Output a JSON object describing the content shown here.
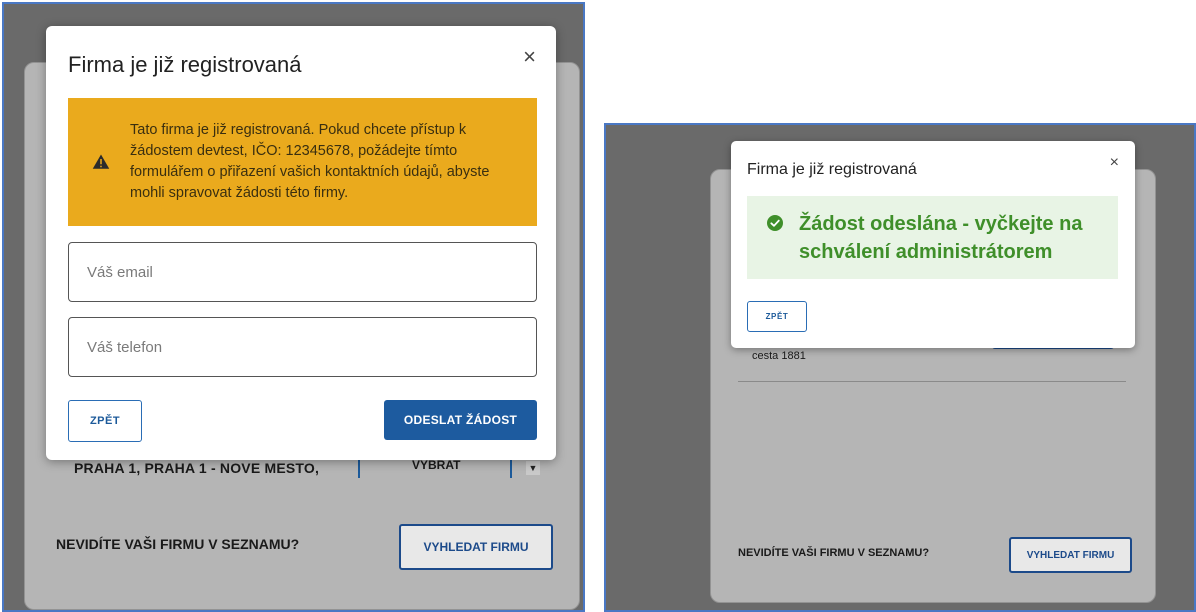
{
  "left": {
    "background": {
      "address": "PRAHA 1, PRAHA 1 - NOVE MESTO,",
      "select_button": "VYBRAT",
      "missing_company": "NEVIDÍTE VAŠI FIRMU V SEZNAMU?",
      "search_button": "VYHLEDAT FIRMU"
    },
    "modal": {
      "title": "Firma je již registrovaná",
      "close": "×",
      "warning": "Tato firma je již registrovaná. Pokud chcete přístup k žádostem devtest, IČO: 12345678, požádejte tímto formulářem o přiřazení vašich kontaktních údajů, abyste mohli spravovat žádosti této firmy.",
      "email_placeholder": "Váš email",
      "phone_placeholder": "Váš telefon",
      "back_button": "ZPĚT",
      "send_button": "ODESLAT ŽÁDOST"
    }
  },
  "right": {
    "background": {
      "street": "cesta 1881",
      "missing_company": "NEVIDÍTE VAŠI FIRMU V SEZNAMU?",
      "search_button": "VYHLEDAT FIRMU"
    },
    "modal": {
      "title": "Firma je již registrovaná",
      "close": "×",
      "success": "Žádost odeslána - vyčkejte na schválení administrátorem",
      "back_button": "ZPĚT"
    }
  },
  "colors": {
    "warning_bg": "#eaaa1d",
    "success_bg": "#e8f4e5",
    "success_text": "#3f8f2a",
    "primary": "#1d5b9f",
    "overlay": "#6a6a6a"
  },
  "icons": {
    "warning": "warning-triangle-icon",
    "success": "check-circle-icon",
    "close": "close-icon"
  }
}
